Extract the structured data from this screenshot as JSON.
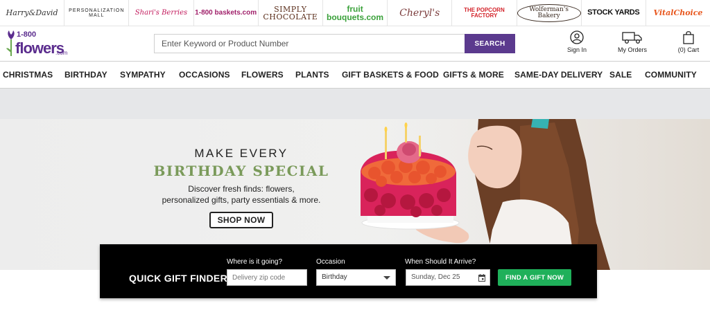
{
  "brands": [
    "Harry&David",
    "Personalization Mall",
    "Shari's Berries",
    "1-800 baskets.com",
    "Simply Chocolate",
    "fruit bouquets.com",
    "Cheryl's",
    "The Popcorn Factory",
    "Wolferman's Bakery",
    "Stock Yards",
    "VitalChoice"
  ],
  "logo": {
    "top": "1-800",
    "main": "flowers",
    "suffix": ".com",
    "color": "#5b2d8e"
  },
  "search": {
    "placeholder": "Enter Keyword or Product Number",
    "button": "SEARCH"
  },
  "account": {
    "signin": "Sign In",
    "orders": "My Orders",
    "cart": "(0) Cart"
  },
  "nav": [
    "CHRISTMAS",
    "BIRTHDAY",
    "SYMPATHY",
    "OCCASIONS",
    "FLOWERS",
    "PLANTS",
    "GIFT BASKETS & FOOD",
    "GIFTS & MORE",
    "SAME-DAY DELIVERY",
    "SALE",
    "COMMUNITY"
  ],
  "hero": {
    "line1": "MAKE EVERY",
    "line2": "BIRTHDAY SPECIAL",
    "sub1": "Discover fresh finds: flowers,",
    "sub2": "personalized gifts, party essentials & more.",
    "cta": "SHOP NOW"
  },
  "finder": {
    "title": "QUICK GIFT FINDER",
    "zip_label": "Where is it going?",
    "zip_placeholder": "Delivery zip code",
    "occasion_label": "Occasion",
    "occasion_value": "Birthday",
    "date_label": "When Should It Arrive?",
    "date_value": "Sunday, Dec 25",
    "button": "FIND A GIFT NOW"
  },
  "colors": {
    "brand": "#5b2d8e",
    "search_button": "#5b3a8e",
    "finder_button": "#1fb05a",
    "hero_accent": "#7a9a5a"
  }
}
